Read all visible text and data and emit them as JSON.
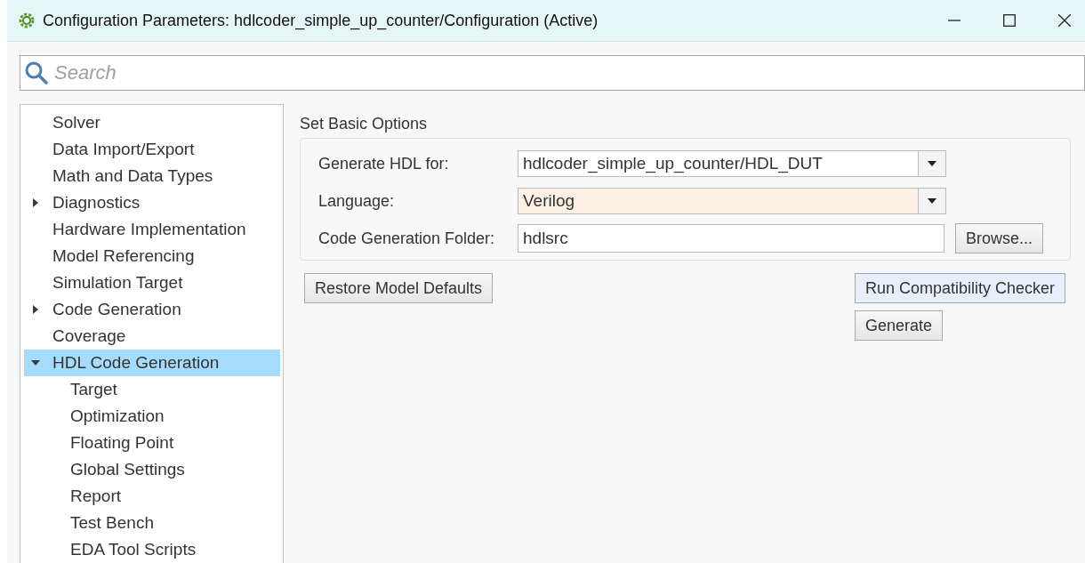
{
  "window": {
    "title": "Configuration Parameters: hdlcoder_simple_up_counter/Configuration (Active)"
  },
  "search": {
    "placeholder": "Search"
  },
  "tree": [
    {
      "label": "Solver",
      "selected": false
    },
    {
      "label": "Data Import/Export",
      "selected": false
    },
    {
      "label": "Math and Data Types",
      "selected": false
    },
    {
      "label": "Diagnostics",
      "selected": false,
      "expanded": false
    },
    {
      "label": "Hardware Implementation",
      "selected": false
    },
    {
      "label": "Model Referencing",
      "selected": false
    },
    {
      "label": "Simulation Target",
      "selected": false
    },
    {
      "label": "Code Generation",
      "selected": false,
      "expanded": false
    },
    {
      "label": "Coverage",
      "selected": false
    },
    {
      "label": "HDL Code Generation",
      "selected": true,
      "expanded": true,
      "children": [
        {
          "label": "Target",
          "selected": false
        },
        {
          "label": "Optimization",
          "selected": false
        },
        {
          "label": "Floating Point",
          "selected": false
        },
        {
          "label": "Global Settings",
          "selected": false
        },
        {
          "label": "Report",
          "selected": false
        },
        {
          "label": "Test Bench",
          "selected": false
        },
        {
          "label": "EDA Tool Scripts",
          "selected": false
        }
      ]
    }
  ],
  "panel": {
    "title": "Set Basic Options",
    "fields": [
      {
        "label": "Generate HDL for:",
        "kind": "dropdown",
        "value": "hdlcoder_simple_up_counter/HDL_DUT",
        "highlighted": false
      },
      {
        "label": "Language:",
        "kind": "dropdown",
        "value": "Verilog",
        "highlighted": true
      },
      {
        "label": "Code Generation Folder:",
        "kind": "text",
        "value": "hdlsrc",
        "highlighted": false,
        "button": "Browse..."
      }
    ],
    "restore_button": "Restore Model Defaults",
    "check_button": "Run Compatibility Checker",
    "generate_button": "Generate"
  }
}
